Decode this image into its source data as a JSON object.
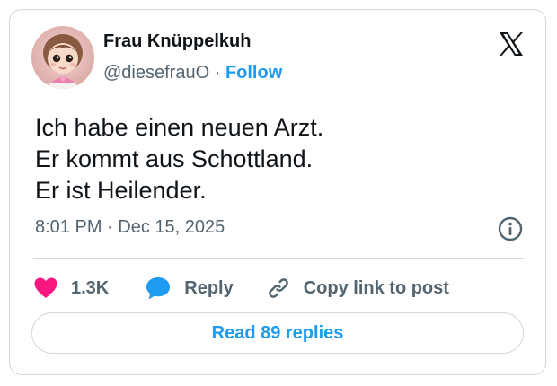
{
  "author": {
    "name": "Frau Knüppelkuh",
    "handle": "@diesefrauO",
    "separator": "·",
    "follow_label": "Follow"
  },
  "tweet": {
    "lines": [
      "Ich habe einen neuen Arzt.",
      "Er kommt aus Schottland.",
      "Er ist Heilender."
    ],
    "time": "8:01 PM",
    "date_separator": "·",
    "date": "Dec 15, 2025"
  },
  "actions": {
    "like_count": "1.3K",
    "reply_label": "Reply",
    "copy_label": "Copy link to post"
  },
  "read_replies_label": "Read 89 replies",
  "icons": {
    "like": "heart-icon",
    "reply": "speech-bubble-icon",
    "copy": "link-icon",
    "info": "info-icon",
    "brand": "x-logo-icon"
  },
  "colors": {
    "like": "#f91880",
    "reply": "#1d9bf0",
    "link_blue": "#1d9bf0",
    "text": "#0f1419",
    "secondary": "#536471",
    "border": "#cfd9de"
  }
}
